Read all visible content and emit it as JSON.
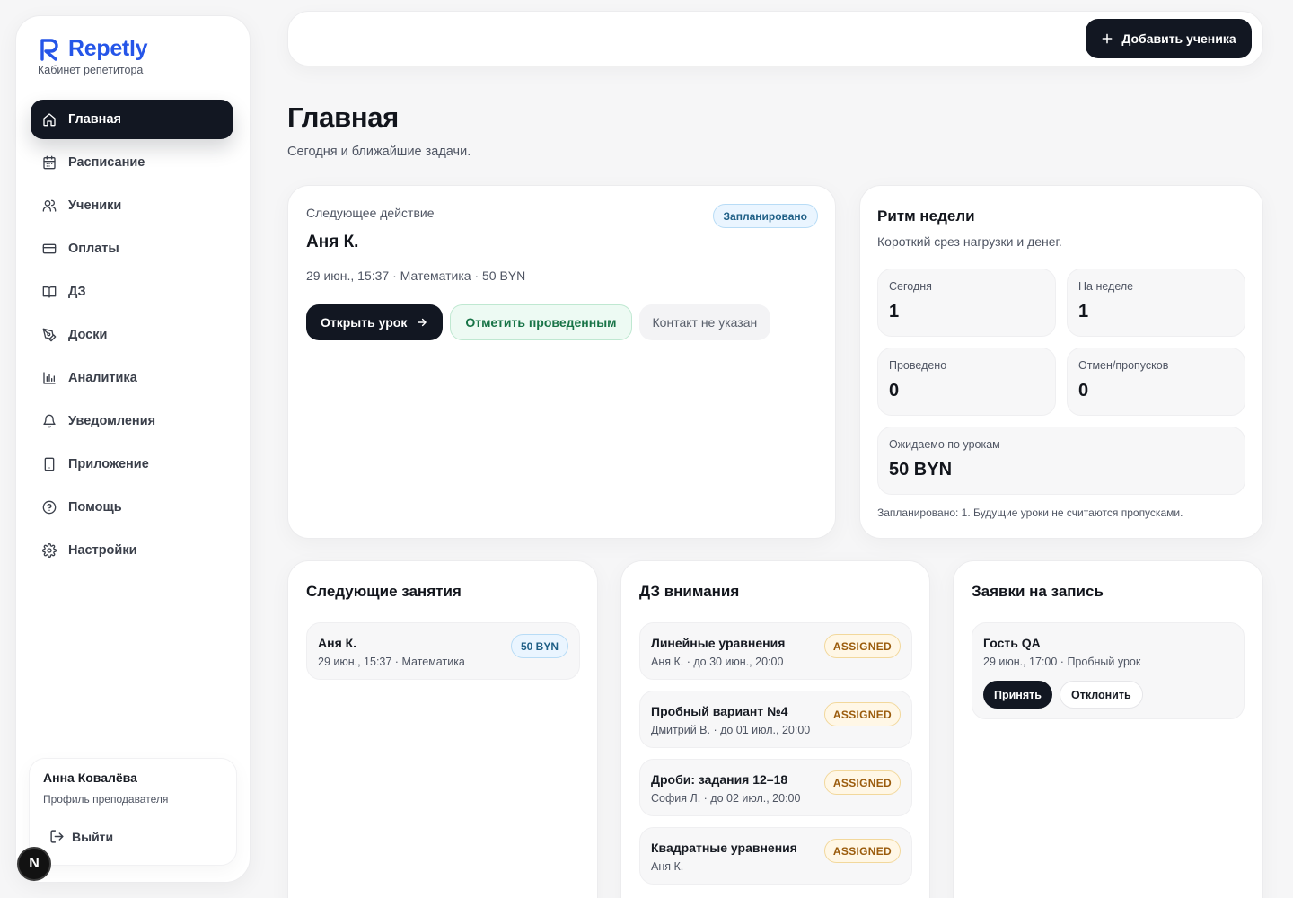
{
  "brand": {
    "name": "Repetly",
    "subtitle": "Кабинет репетитора",
    "accent": "#2555e8"
  },
  "sidebar": {
    "items": [
      {
        "label": "Главная",
        "icon": "home-icon",
        "active": true
      },
      {
        "label": "Расписание",
        "icon": "calendar-icon"
      },
      {
        "label": "Ученики",
        "icon": "users-icon"
      },
      {
        "label": "Оплаты",
        "icon": "credit-card-icon"
      },
      {
        "label": "ДЗ",
        "icon": "book-icon"
      },
      {
        "label": "Доски",
        "icon": "pen-icon"
      },
      {
        "label": "Аналитика",
        "icon": "bar-chart-icon"
      },
      {
        "label": "Уведомления",
        "icon": "bell-icon"
      },
      {
        "label": "Приложение",
        "icon": "smartphone-icon"
      },
      {
        "label": "Помощь",
        "icon": "help-circle-icon"
      },
      {
        "label": "Настройки",
        "icon": "gear-icon"
      }
    ]
  },
  "profile": {
    "name": "Анна Ковалёва",
    "role": "Профиль преподавателя",
    "logout": "Выйти"
  },
  "dev_badge": "N",
  "topbar": {
    "add_student": "Добавить ученика"
  },
  "page": {
    "title": "Главная",
    "subtitle": "Сегодня и ближайшие задачи."
  },
  "next_action": {
    "label": "Следующее действие",
    "status": "Запланировано",
    "student": "Аня К.",
    "meta": "29 июн., 15:37 · Математика · 50 BYN",
    "open_lesson": "Открыть урок",
    "mark_done": "Отметить проведенным",
    "contact": "Контакт не указан"
  },
  "rhythm": {
    "title": "Ритм недели",
    "subtitle": "Короткий срез нагрузки и денег.",
    "stats": [
      {
        "label": "Сегодня",
        "value": "1"
      },
      {
        "label": "На неделе",
        "value": "1"
      },
      {
        "label": "Проведено",
        "value": "0"
      },
      {
        "label": "Отмен/пропусков",
        "value": "0"
      },
      {
        "label": "Ожидаемо по урокам",
        "value": "50 BYN"
      }
    ],
    "note": "Запланировано: 1. Будущие уроки не считаются пропусками."
  },
  "upcoming": {
    "title": "Следующие занятия",
    "items": [
      {
        "name": "Аня К.",
        "meta": "29 июн., 15:37 · Математика",
        "price": "50 BYN"
      }
    ]
  },
  "homework": {
    "title": "ДЗ внимания",
    "items": [
      {
        "title": "Линейные уравнения",
        "meta": "Аня К. · до 30 июн., 20:00",
        "status": "ASSIGNED"
      },
      {
        "title": "Пробный вариант №4",
        "meta": "Дмитрий В. · до 01 июл., 20:00",
        "status": "ASSIGNED"
      },
      {
        "title": "Дроби: задания 12–18",
        "meta": "София Л. · до 02 июл., 20:00",
        "status": "ASSIGNED"
      },
      {
        "title": "Квадратные уравнения",
        "meta": "Аня К.",
        "status": "ASSIGNED"
      }
    ]
  },
  "requests": {
    "title": "Заявки на запись",
    "items": [
      {
        "name": "Гость QA",
        "meta": "29 июн., 17:00 · Пробный урок",
        "accept": "Принять",
        "decline": "Отклонить"
      }
    ]
  }
}
